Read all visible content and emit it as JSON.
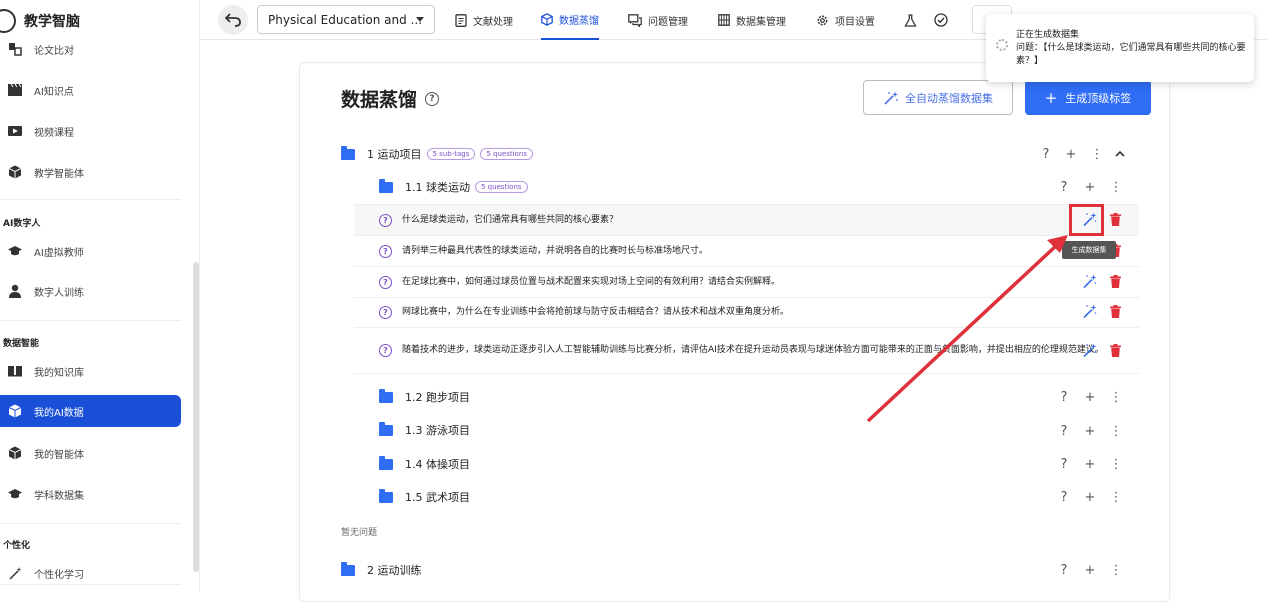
{
  "app": {
    "title": "教学智脑"
  },
  "sidebar": {
    "items_top": [
      {
        "label": "论文比对",
        "icon": "compare-icon"
      },
      {
        "label": "AI知识点",
        "icon": "clapperboard-icon"
      },
      {
        "label": "视频课程",
        "icon": "video-icon"
      },
      {
        "label": "教学智能体",
        "icon": "cube-icon"
      }
    ],
    "group_digital": "AI数字人",
    "items_digital": [
      {
        "label": "AI虚拟教师",
        "icon": "graduation-cap-icon"
      },
      {
        "label": "数字人训练",
        "icon": "person-icon"
      }
    ],
    "group_data": "数据智能",
    "items_data": [
      {
        "label": "我的知识库",
        "icon": "book-icon"
      },
      {
        "label": "我的AI数据",
        "icon": "cube-data-icon"
      },
      {
        "label": "我的智能体",
        "icon": "cube-icon"
      },
      {
        "label": "学科数据集",
        "icon": "graduation-cap-icon"
      }
    ],
    "group_personal": "个性化",
    "items_personal": [
      {
        "label": "个性化学习",
        "icon": "wand-icon"
      }
    ]
  },
  "topbar": {
    "project": "Physical Education and ...",
    "tabs": [
      {
        "label": "文献处理",
        "icon": "document-icon"
      },
      {
        "label": "数据蒸馏",
        "icon": "cube-icon"
      },
      {
        "label": "问题管理",
        "icon": "chat-icon"
      },
      {
        "label": "数据集管理",
        "icon": "grid-icon"
      },
      {
        "label": "项目设置",
        "icon": "gear-icon"
      }
    ],
    "active_tab": "数据蒸馏"
  },
  "main": {
    "title": "数据蒸馏",
    "btn_auto": "全自动蒸馏数据集",
    "btn_generate": "生成顶级标签",
    "tag1": {
      "label": "1 运动项目",
      "subtags": "5 sub-tags",
      "questions": "5 questions"
    },
    "tag11": {
      "label": "1.1 球类运动",
      "questions": "5 questions"
    },
    "questions": [
      "什么是球类运动，它们通常具有哪些共同的核心要素？",
      "请列举三种最具代表性的球类运动，并说明各自的比赛时长与标准场地尺寸。",
      "在足球比赛中，如何通过球员位置与战术配置来实现对场上空间的有效利用？请结合实例解释。",
      "网球比赛中，为什么在专业训练中会将抢前球与防守反击相结合？请从技术和战术双重角度分析。",
      "随着技术的进步，球类运动正逐步引入人工智能辅助训练与比赛分析，请评估AI技术在提升运动员表现与球迷体验方面可能带来的正面与负面影响，并提出相应的伦理规范建议。"
    ],
    "subtags": [
      "1.2 跑步项目",
      "1.3 游泳项目",
      "1.4 体操项目",
      "1.5 武术项目"
    ],
    "empty_text": "暂无问题",
    "tag2": {
      "label": "2 运动训练"
    },
    "tooltip": "生成数据集"
  },
  "toast": {
    "title": "正在生成数据集",
    "body": "问题：【什么是球类运动，它们通常具有哪些共同的核心要素？】"
  },
  "colors": {
    "accent": "#2f6df5",
    "active_nav": "#1a4fd8",
    "delete": "#e0303a",
    "annotation": "#e0303a"
  }
}
